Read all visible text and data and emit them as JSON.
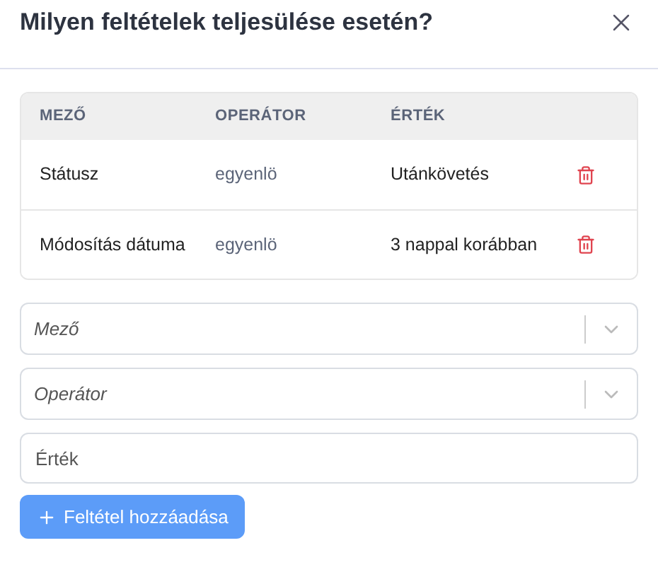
{
  "dialog": {
    "title": "Milyen feltételek teljesülése esetén?"
  },
  "table": {
    "columns": [
      "MEZŐ",
      "OPERÁTOR",
      "ÉRTÉK"
    ],
    "rows": [
      {
        "field": "Státusz",
        "operator": "egyenlö",
        "value": "Utánkövetés"
      },
      {
        "field": "Módosítás dátuma",
        "operator": "egyenlö",
        "value": "3 nappal korábban"
      }
    ]
  },
  "form": {
    "field_select": {
      "placeholder": "Mező"
    },
    "operator_select": {
      "placeholder": "Operátor"
    },
    "value_input": {
      "placeholder": "Érték"
    },
    "add_button": {
      "label": "Feltétel hozzáadása"
    }
  }
}
